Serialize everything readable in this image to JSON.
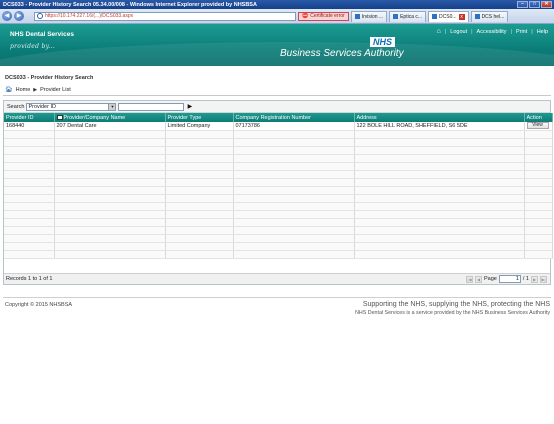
{
  "window": {
    "title": "DCS033 - Provider History Search 05.34.00/008 - Windows Internet Explorer provided by NHSBSA",
    "url": "https://10.174.227.16/(...)/DCS033.aspx",
    "cert_error": "Certificate error",
    "tabs": [
      "Irvision ...",
      "Eptica c...",
      "DCS0...",
      "DCS hel..."
    ]
  },
  "header": {
    "brand": "NHS Dental Services",
    "byline": "provided by...",
    "nav": [
      "Logout",
      "Accessibility",
      "Print",
      "Help"
    ],
    "logo": "NHS",
    "authority": "Business Services Authority"
  },
  "page": {
    "title": "DCS033 - Provider History Search",
    "breadcrumb": [
      "Home",
      "Provider List"
    ]
  },
  "search": {
    "label": "Search",
    "selected": "Provider ID",
    "value": ""
  },
  "table": {
    "columns": [
      "Provider ID",
      "Provider/Company Name",
      "Provider Type",
      "Company Registration Number",
      "Address",
      "Action"
    ],
    "rows": [
      [
        "168440",
        "207 Dental Care",
        "Limited Company",
        "07173786",
        "122 BOLE HILL ROAD, SHEFFIELD, S6 5DE",
        "View"
      ]
    ],
    "records": "Records 1 to 1 of 1",
    "page_label": "Page",
    "page_value": "1",
    "page_total": "/ 1"
  },
  "footer": {
    "copyright": "Copyright © 2015 NHSBSA",
    "support": "Supporting the NHS, supplying the NHS, protecting the NHS",
    "service": "NHS Dental Services is a service provided by the NHS Business Services Authority"
  }
}
